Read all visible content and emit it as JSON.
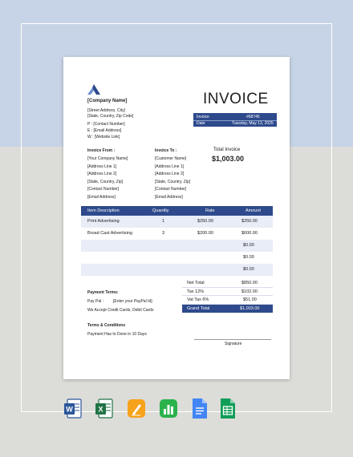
{
  "company": {
    "name": "[Company Name]",
    "address1": "[Street Address, City]",
    "address2": "[State, Country, Zip Code]",
    "phone": "P : [Contact Number]",
    "email": "E : [Email Address]",
    "web": "W : [Website Link]"
  },
  "invoice": {
    "title": "INVOICE",
    "number_label": "Invoice",
    "number_value": "#68745",
    "date_label": "Date",
    "date_value": "Tuesday, May 13, 2025"
  },
  "from": {
    "heading": "Invoice From :",
    "lines": [
      "[Your Company Name]",
      "[Address Line 1]",
      "[Address Line 2]",
      "[State, Country, Zip]",
      "[Contact Number]",
      "[Email Address]"
    ]
  },
  "to": {
    "heading": "Invoice To :",
    "lines": [
      "[Customer Name]",
      "[Address Line 1]",
      "[Address Line 2]",
      "[State, Country, Zip]",
      "[Contact Number]",
      "[Email Address]"
    ]
  },
  "total": {
    "label": "Total Invoice",
    "value": "$1,003.00"
  },
  "table": {
    "headers": [
      "Item Description",
      "Quantity",
      "Rate",
      "Amount"
    ],
    "rows": [
      [
        "Print Advertising",
        "1",
        "$250.00",
        "$250.00"
      ],
      [
        "Broad Cast Advertising",
        "3",
        "$200.00",
        "$600.00"
      ],
      [
        "",
        "",
        "",
        "$0.00"
      ],
      [
        "",
        "",
        "",
        "$0.00"
      ],
      [
        "",
        "",
        "",
        "$0.00"
      ]
    ]
  },
  "summary": [
    [
      "Net Total",
      "$850.00"
    ],
    [
      "Tax 12%",
      "$102.00"
    ],
    [
      "Vat Tax 6%",
      "$51.00"
    ],
    [
      "Grand Total",
      "$1,003.00"
    ]
  ],
  "payment": {
    "heading": "Payment Terms:",
    "paypal_label": "Pay Pal :",
    "paypal_value": "[Enter your PayPal Id]",
    "cards": "We Accept Credit Cards, Debit Cards"
  },
  "terms": {
    "heading": "Terms & Conditions",
    "text": "Payment Has to Done in 10 Days"
  },
  "signature": "Signature",
  "app_icons": [
    "word-icon",
    "excel-icon",
    "pages-icon",
    "numbers-icon",
    "google-docs-icon",
    "google-sheets-icon"
  ],
  "colors": {
    "accent": "#2e4a8c",
    "row_light": "#e8edf7"
  }
}
